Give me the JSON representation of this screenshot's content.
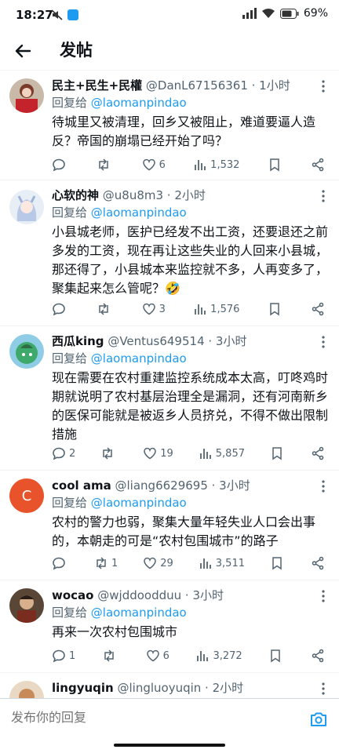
{
  "status_bar": {
    "time": "18:27",
    "battery": "69%"
  },
  "header": {
    "title": "发帖"
  },
  "reply_prefix": "回复给 ",
  "tweets": [
    {
      "name": "民主+民生+民權",
      "meta": " @DanL67156361 · 1小时",
      "reply_to": "@laomanpindao",
      "text": "待城里又被清理，回乡又被阻止，难道要逼人造反？帝国的崩塌已经开始了吗？",
      "replies": "",
      "retweets": "",
      "likes": "6",
      "views": "1,532"
    },
    {
      "name": "心软的神",
      "meta": " @u8u8m3 · 2小时",
      "reply_to": "@laomanpindao",
      "text": "小县城老师，医护已经发不出工资，还要退还之前多发的工资，现在再让这些失业的人回来小县城，那还得了，小县城本来监控就不多，人再变多了，聚集起来怎么管呢？🤣",
      "replies": "",
      "retweets": "",
      "likes": "3",
      "views": "1,576"
    },
    {
      "name": "西瓜king",
      "meta": " @Ventus649514 · 3小时",
      "reply_to": "@laomanpindao",
      "text": "现在需要在农村重建监控系统成本太高，叮咚鸡时期就说明了农村基层治理全是漏洞，还有河南新乡的医保可能就是被返乡人员挤兑，不得不做出限制措施",
      "replies": "2",
      "retweets": "",
      "likes": "19",
      "views": "5,857"
    },
    {
      "name": "cool ama",
      "meta": " @liang6629695 · 3小时",
      "reply_to": "@laomanpindao",
      "text": "农村的警力也弱，聚集大量年轻失业人口会出事的，本朝走的可是“农村包围城市”的路子",
      "replies": "",
      "retweets": "1",
      "likes": "29",
      "views": "3,511",
      "avatar_letter": "C"
    },
    {
      "name": "wocao",
      "meta": " @wjddoodduu · 3小时",
      "reply_to": "@laomanpindao",
      "text": "再来一次农村包围城市",
      "replies": "1",
      "retweets": "",
      "likes": "6",
      "views": "3,272"
    },
    {
      "name": "lingyuqin",
      "meta": " @lingluoyuqin · 2小时"
    }
  ],
  "reply_bar": {
    "placeholder": "发布你的回复"
  },
  "colors": {
    "accent": "#1d9bf0",
    "text": "#0f1419",
    "muted": "#536471",
    "avatar_c": "#e8532b"
  }
}
